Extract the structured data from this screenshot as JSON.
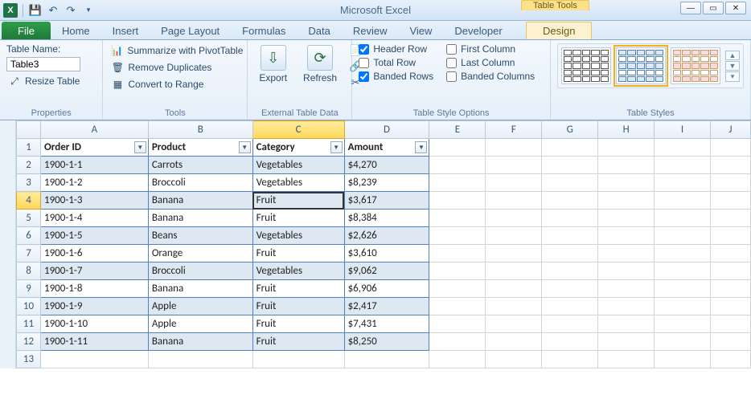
{
  "titlebar": {
    "app_title": "Microsoft Excel",
    "context_caption": "Table Tools"
  },
  "qat": {
    "app_icon_letter": "X"
  },
  "win": {
    "min": "—",
    "max": "▭",
    "close": "✕"
  },
  "tabs": {
    "file": "File",
    "items": [
      "Home",
      "Insert",
      "Page Layout",
      "Formulas",
      "Data",
      "Review",
      "View",
      "Developer"
    ],
    "context_active": "Design"
  },
  "ribbon": {
    "properties": {
      "label": "Properties",
      "table_name_label": "Table Name:",
      "table_name_value": "Table3",
      "resize_label": "Resize Table"
    },
    "tools": {
      "label": "Tools",
      "pivot": "Summarize with PivotTable",
      "dupes": "Remove Duplicates",
      "range": "Convert to Range"
    },
    "external": {
      "label": "External Table Data",
      "export": "Export",
      "refresh": "Refresh"
    },
    "styleopts": {
      "label": "Table Style Options",
      "opts": [
        {
          "label": "Header Row",
          "checked": true
        },
        {
          "label": "Total Row",
          "checked": false
        },
        {
          "label": "Banded Rows",
          "checked": true
        },
        {
          "label": "First Column",
          "checked": false
        },
        {
          "label": "Last Column",
          "checked": false
        },
        {
          "label": "Banded Columns",
          "checked": false
        }
      ]
    },
    "styles": {
      "label": "Table Styles"
    }
  },
  "columns": [
    "A",
    "B",
    "C",
    "D",
    "E",
    "F",
    "G",
    "H",
    "I",
    "J"
  ],
  "active": {
    "col": "C",
    "row": 4
  },
  "table_headers": [
    "Order ID",
    "Product",
    "Category",
    "Amount"
  ],
  "rows": [
    {
      "n": 1
    },
    {
      "n": 2,
      "cells": [
        "1900-1-1",
        "Carrots",
        "Vegetables",
        "$4,270"
      ],
      "band": true
    },
    {
      "n": 3,
      "cells": [
        "1900-1-2",
        "Broccoli",
        "Vegetables",
        "$8,239"
      ]
    },
    {
      "n": 4,
      "cells": [
        "1900-1-3",
        "Banana",
        "Fruit",
        "$3,617"
      ],
      "band": true
    },
    {
      "n": 5,
      "cells": [
        "1900-1-4",
        "Banana",
        "Fruit",
        "$8,384"
      ]
    },
    {
      "n": 6,
      "cells": [
        "1900-1-5",
        "Beans",
        "Vegetables",
        "$2,626"
      ],
      "band": true
    },
    {
      "n": 7,
      "cells": [
        "1900-1-6",
        "Orange",
        "Fruit",
        "$3,610"
      ]
    },
    {
      "n": 8,
      "cells": [
        "1900-1-7",
        "Broccoli",
        "Vegetables",
        "$9,062"
      ],
      "band": true
    },
    {
      "n": 9,
      "cells": [
        "1900-1-8",
        "Banana",
        "Fruit",
        "$6,906"
      ]
    },
    {
      "n": 10,
      "cells": [
        "1900-1-9",
        "Apple",
        "Fruit",
        "$2,417"
      ],
      "band": true
    },
    {
      "n": 11,
      "cells": [
        "1900-1-10",
        "Apple",
        "Fruit",
        "$7,431"
      ]
    },
    {
      "n": 12,
      "cells": [
        "1900-1-11",
        "Banana",
        "Fruit",
        "$8,250"
      ],
      "band": true
    },
    {
      "n": 13
    }
  ],
  "chart_data": {
    "type": "table",
    "columns": [
      "Order ID",
      "Product",
      "Category",
      "Amount"
    ],
    "rows": [
      [
        "1900-1-1",
        "Carrots",
        "Vegetables",
        4270
      ],
      [
        "1900-1-2",
        "Broccoli",
        "Vegetables",
        8239
      ],
      [
        "1900-1-3",
        "Banana",
        "Fruit",
        3617
      ],
      [
        "1900-1-4",
        "Banana",
        "Fruit",
        8384
      ],
      [
        "1900-1-5",
        "Beans",
        "Vegetables",
        2626
      ],
      [
        "1900-1-6",
        "Orange",
        "Fruit",
        3610
      ],
      [
        "1900-1-7",
        "Broccoli",
        "Vegetables",
        9062
      ],
      [
        "1900-1-8",
        "Banana",
        "Fruit",
        6906
      ],
      [
        "1900-1-9",
        "Apple",
        "Fruit",
        2417
      ],
      [
        "1900-1-10",
        "Apple",
        "Fruit",
        7431
      ],
      [
        "1900-1-11",
        "Banana",
        "Fruit",
        8250
      ]
    ]
  }
}
